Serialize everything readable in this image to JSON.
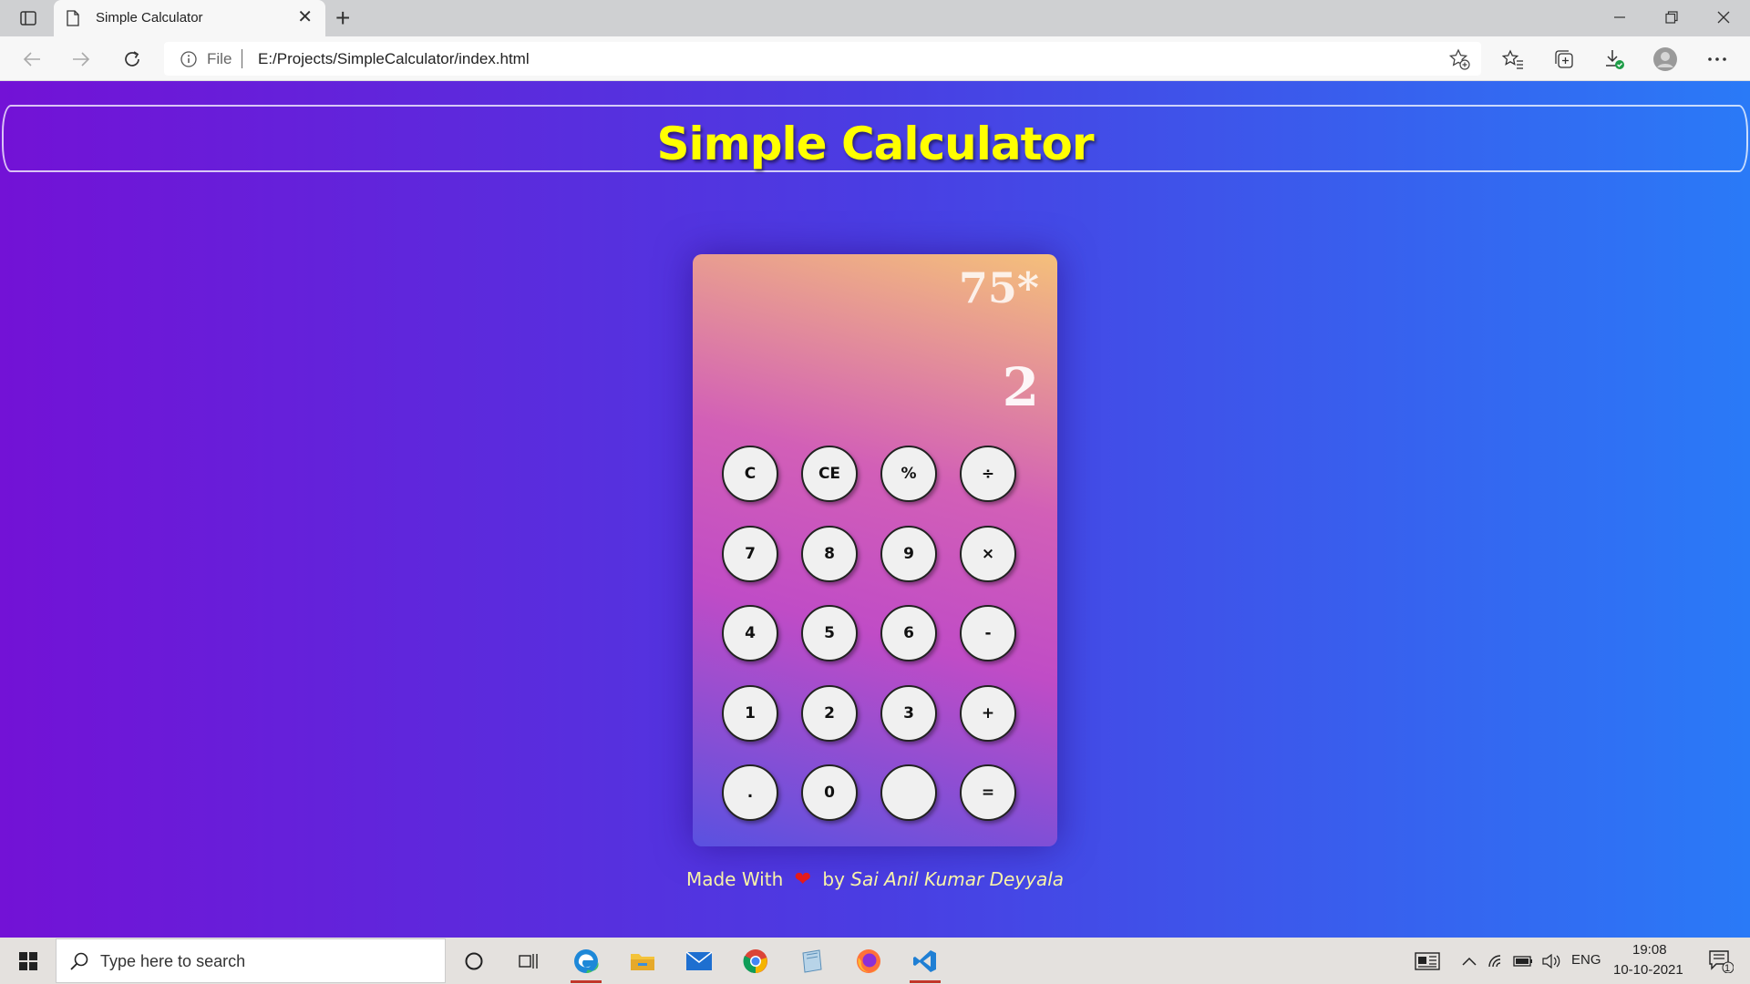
{
  "browser": {
    "tab_title": "Simple Calculator",
    "url_scheme": "File",
    "url": "E:/Projects/SimpleCalculator/index.html"
  },
  "page": {
    "header_title": "Simple Calculator",
    "display": {
      "previous": "75*",
      "current": "2"
    },
    "keys": [
      [
        "C",
        "CE",
        "%",
        "÷"
      ],
      [
        "7",
        "8",
        "9",
        "×"
      ],
      [
        "4",
        "5",
        "6",
        "-"
      ],
      [
        "1",
        "2",
        "3",
        "+"
      ],
      [
        ".",
        "0",
        "",
        "="
      ]
    ],
    "footer": {
      "made_with": "Made With",
      "by": "by",
      "author": "Sai Anil Kumar Deyyala"
    }
  },
  "taskbar": {
    "search_placeholder": "Type here to search",
    "language": "ENG",
    "time": "19:08",
    "date": "10-10-2021",
    "notification_count": "1"
  },
  "colors": {
    "header_title": "#ffff00",
    "page_gradient_start": "#7312d6",
    "page_gradient_end": "#2a7af7",
    "footer_text": "#f8f3a8",
    "heart": "#e51a1a"
  }
}
